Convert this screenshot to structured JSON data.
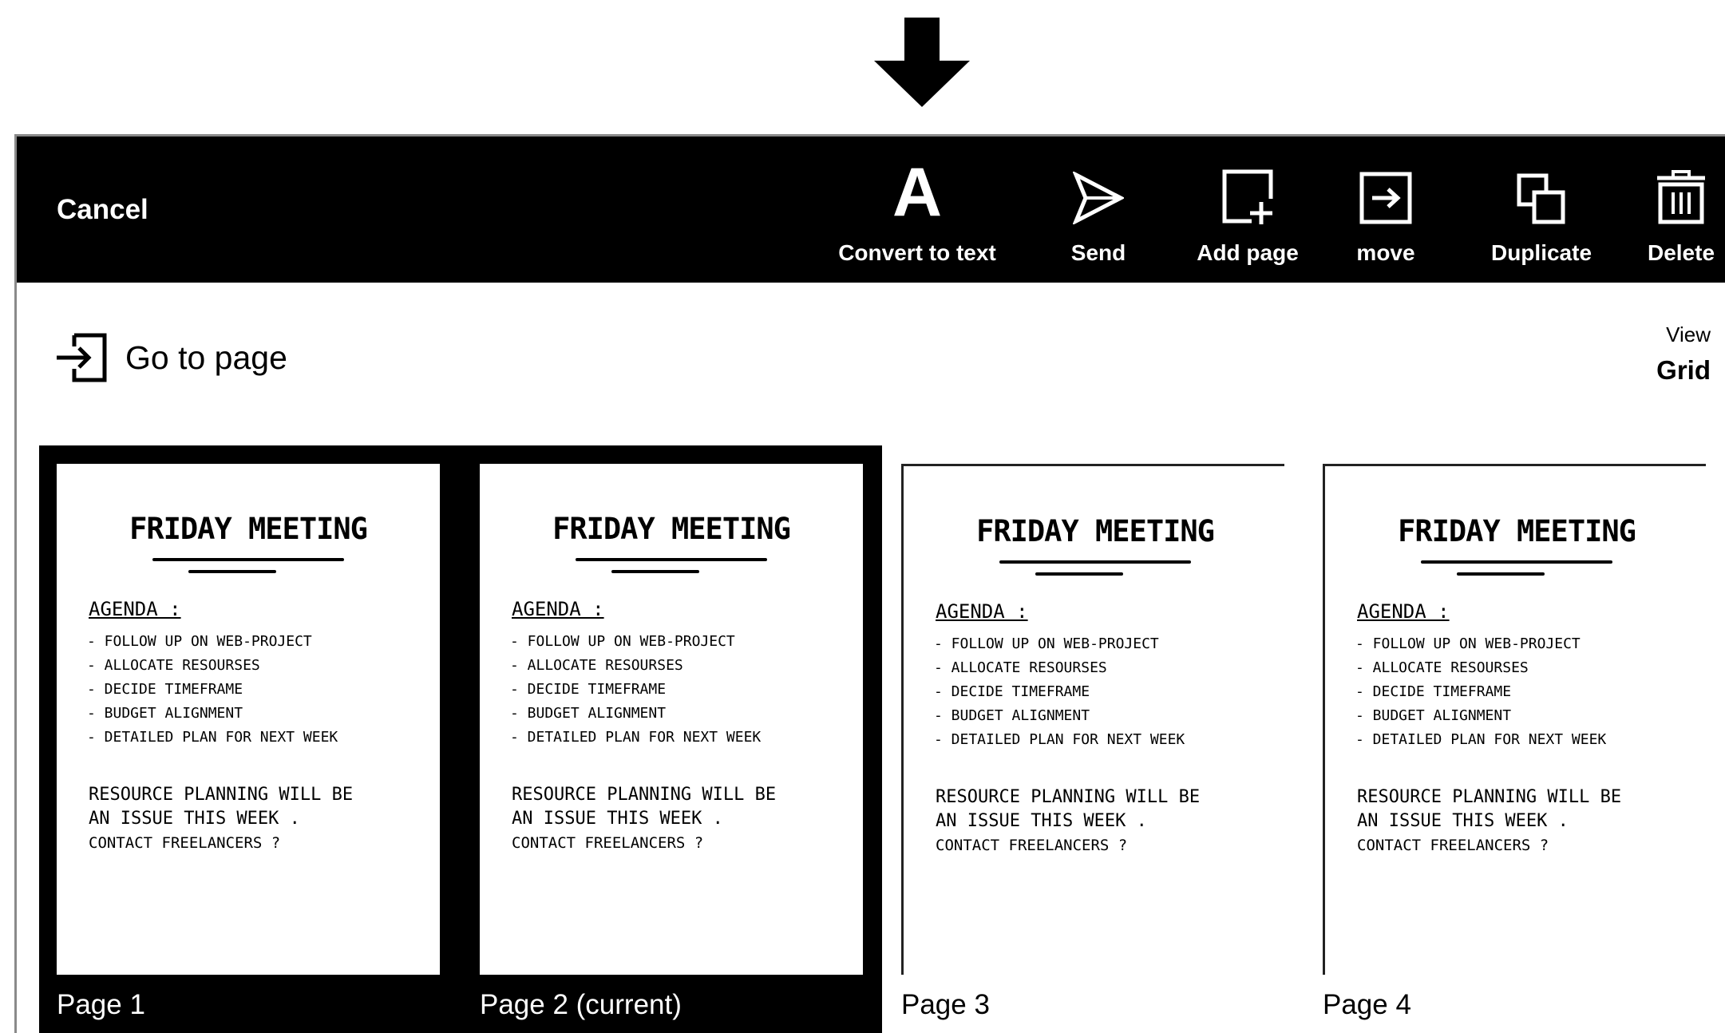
{
  "toolbar": {
    "cancel_label": "Cancel",
    "tools": {
      "convert": {
        "label": "Convert to text",
        "icon_glyph": "A",
        "icon": "letter-a-icon"
      },
      "send": {
        "label": "Send",
        "icon": "send-icon"
      },
      "add_page": {
        "label": "Add page",
        "icon": "add-page-icon"
      },
      "move": {
        "label": "move",
        "icon": "move-icon"
      },
      "duplicate": {
        "label": "Duplicate",
        "icon": "duplicate-icon"
      },
      "delete": {
        "label": "Delete",
        "icon": "trash-icon"
      }
    }
  },
  "goto": {
    "label": "Go to page",
    "icon": "go-to-page-icon"
  },
  "view": {
    "caption": "View",
    "value": "Grid"
  },
  "pages": [
    {
      "label": "Page 1",
      "selected": true
    },
    {
      "label": "Page 2 (current)",
      "selected": true
    },
    {
      "label": "Page 3",
      "selected": false
    },
    {
      "label": "Page 4",
      "selected": false
    }
  ],
  "note": {
    "title": "FRIDAY MEETING",
    "agenda": "AGENDA :",
    "items": [
      "- FOLLOW UP ON WEB-PROJECT",
      "- ALLOCATE RESOURSES",
      "- DECIDE TIMEFRAME",
      "- BUDGET ALIGNMENT",
      "- DETAILED PLAN FOR NEXT WEEK"
    ],
    "resource_line1": "RESOURCE PLANNING WILL BE",
    "resource_line2": "AN ISSUE THIS WEEK .",
    "resource_line3": "CONTACT FREELANCERS ?"
  },
  "colors": {
    "toolbar_bg": "#000000",
    "selection_bg": "#000000",
    "page_bg": "#ffffff"
  }
}
